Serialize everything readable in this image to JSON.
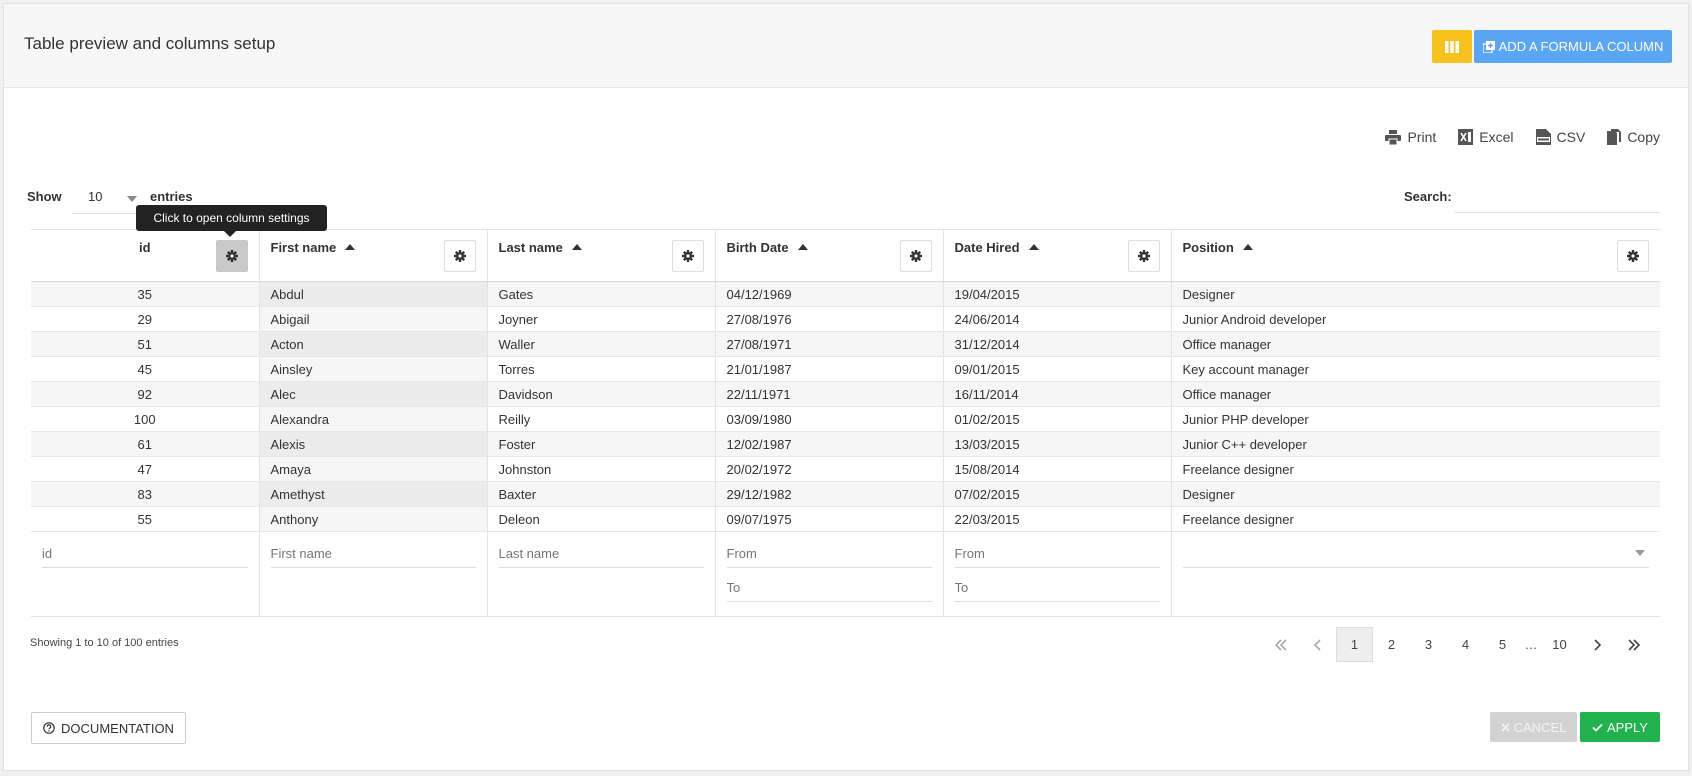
{
  "header": {
    "title": "Table preview and columns setup",
    "columns_button_icon": "columns-icon",
    "formula_button_label": "ADD A FORMULA COLUMN",
    "formula_button_icon": "add-copy-icon",
    "columns_button_color": "#f8c21d",
    "formula_button_color": "#5ba5f5"
  },
  "exports": {
    "print": "Print",
    "excel": "Excel",
    "csv": "CSV",
    "copy": "Copy"
  },
  "length": {
    "show_label": "Show",
    "value": "10",
    "entries_label": "entries"
  },
  "search": {
    "label": "Search:",
    "value": ""
  },
  "tooltip": "Click to open column settings",
  "columns": [
    "id",
    "First name",
    "Last name",
    "Birth Date",
    "Date Hired",
    "Position"
  ],
  "rows": [
    [
      "35",
      "Abdul",
      "Gates",
      "04/12/1969",
      "19/04/2015",
      "Designer"
    ],
    [
      "29",
      "Abigail",
      "Joyner",
      "27/08/1976",
      "24/06/2014",
      "Junior Android developer"
    ],
    [
      "51",
      "Acton",
      "Waller",
      "27/08/1971",
      "31/12/2014",
      "Office manager"
    ],
    [
      "45",
      "Ainsley",
      "Torres",
      "21/01/1987",
      "09/01/2015",
      "Key account manager"
    ],
    [
      "92",
      "Alec",
      "Davidson",
      "22/11/1971",
      "16/11/2014",
      "Office manager"
    ],
    [
      "100",
      "Alexandra",
      "Reilly",
      "03/09/1980",
      "01/02/2015",
      "Junior PHP developer"
    ],
    [
      "61",
      "Alexis",
      "Foster",
      "12/02/1987",
      "13/03/2015",
      "Junior C++ developer"
    ],
    [
      "47",
      "Amaya",
      "Johnston",
      "20/02/1972",
      "15/08/2014",
      "Freelance designer"
    ],
    [
      "83",
      "Amethyst",
      "Baxter",
      "29/12/1982",
      "07/02/2015",
      "Designer"
    ],
    [
      "55",
      "Anthony",
      "Deleon",
      "09/07/1975",
      "22/03/2015",
      "Freelance designer"
    ]
  ],
  "filters": {
    "id": "id",
    "first_name": "First name",
    "last_name": "Last name",
    "birth_from": "From",
    "birth_to": "To",
    "hired_from": "From",
    "hired_to": "To"
  },
  "info": "Showing 1 to 10 of 100 entries",
  "pager": {
    "pages": [
      "1",
      "2",
      "3",
      "4",
      "5"
    ],
    "ellipsis": "…",
    "last": "10",
    "current": "1"
  },
  "footer": {
    "documentation": "DOCUMENTATION",
    "cancel": "CANCEL",
    "apply": "APPLY",
    "apply_color": "#1fb24d"
  }
}
